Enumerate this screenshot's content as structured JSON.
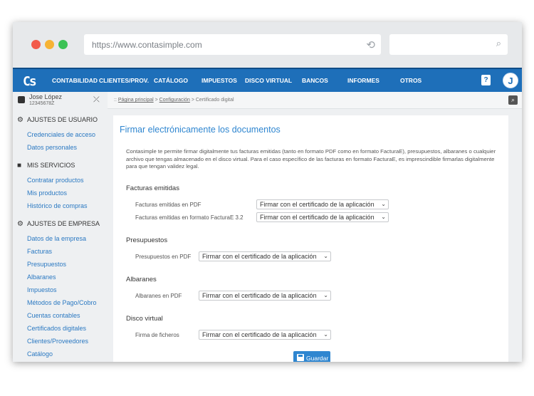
{
  "browser": {
    "url": "https://www.contasimple.com",
    "reload_icon": "reload-icon",
    "search_icon": "search-icon"
  },
  "nav": {
    "logo": "Cs",
    "items": [
      "CONTABILIDAD",
      "CLIENTES/PROV.",
      "CATÁLOGO",
      "IMPUESTOS",
      "DISCO VIRTUAL",
      "BANCOS",
      "INFORMES",
      "OTROS"
    ],
    "help": "?",
    "avatar": "J"
  },
  "user": {
    "name": "Jose López",
    "id": "12345678Z"
  },
  "sidebar": {
    "sections": [
      {
        "title": "AJUSTES DE USUARIO",
        "icon": "gear-icon",
        "items": [
          "Credenciales de acceso",
          "Datos personales"
        ]
      },
      {
        "title": "MIS SERVICIOS",
        "icon": "bag-icon",
        "items": [
          "Contratar productos",
          "Mis productos",
          "Histórico de compras"
        ]
      },
      {
        "title": "AJUSTES DE EMPRESA",
        "icon": "gear-icon",
        "items": [
          "Datos de la empresa",
          "Facturas",
          "Presupuestos",
          "Albaranes",
          "Impuestos",
          "Métodos de Pago/Cobro",
          "Cuentas contables",
          "Certificados digitales",
          "Clientes/Proveedores",
          "Catálogo"
        ]
      }
    ]
  },
  "breadcrumb": {
    "prefix": "::",
    "home": "Página principal",
    "sep": ">",
    "config": "Configuración",
    "current": "Certificado digital"
  },
  "page": {
    "title": "Firmar electrónicamente los documentos",
    "description": "Contasimple te permite firmar digitalmente tus facturas emitidas (tanto en formato PDF como en formato FacturaE), presupuestos, albaranes o cualquier archivo que tengas almacenado en el disco virtual. Para el caso específico de las facturas en formato FacturaE, es imprescindible firmarlas digitalmente para que tengan validez legal.",
    "sections": {
      "facturas": {
        "title": "Facturas emitidas",
        "fields": [
          {
            "label": "Facturas emitidas en PDF",
            "value": "Firmar con el certificado de la aplicación"
          },
          {
            "label": "Facturas emitidas en formato FacturaE 3.2",
            "value": "Firmar con el certificado de la aplicación"
          }
        ]
      },
      "presupuestos": {
        "title": "Presupuestos",
        "fields": [
          {
            "label": "Presupuestos en PDF",
            "value": "Firmar con el certificado de la aplicación"
          }
        ]
      },
      "albaranes": {
        "title": "Albaranes",
        "fields": [
          {
            "label": "Albaranes en PDF",
            "value": "Firmar con el certificado de la aplicación"
          }
        ]
      },
      "disco": {
        "title": "Disco virtual",
        "fields": [
          {
            "label": "Firma de ficheros",
            "value": "Firmar con el certificado de la aplicación"
          }
        ]
      }
    },
    "save_label": "Guardar"
  },
  "colors": {
    "nav_bg": "#1e6fb9",
    "link": "#2b79c2",
    "title": "#2f86d0"
  }
}
